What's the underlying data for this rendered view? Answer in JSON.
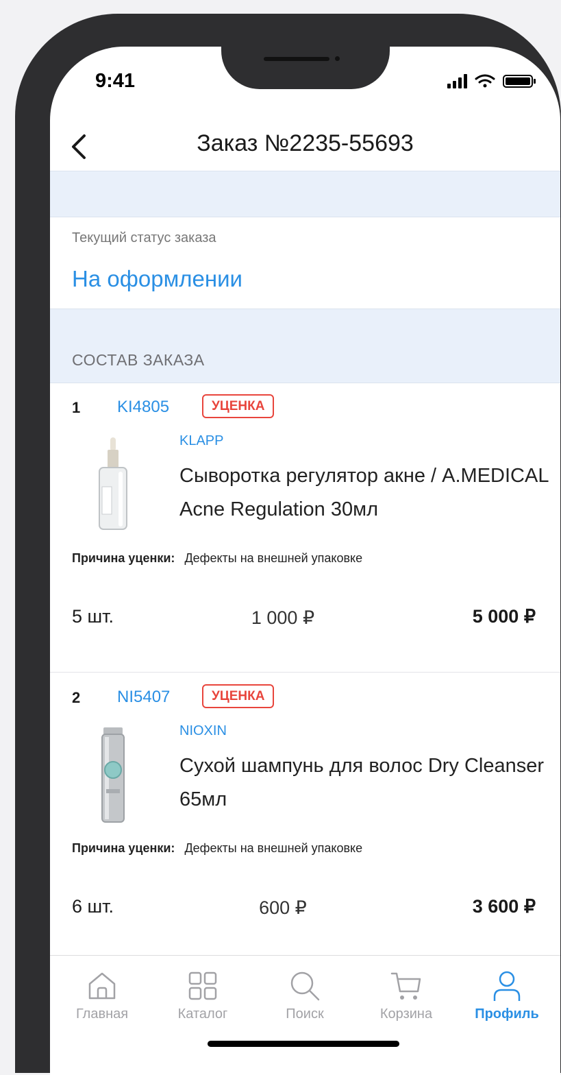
{
  "status_bar": {
    "time": "9:41"
  },
  "header": {
    "title": "Заказ №2235-55693"
  },
  "order_status": {
    "label": "Текущий статус заказа",
    "value": "На оформлении"
  },
  "section": {
    "title": "СОСТАВ ЗАКАЗА"
  },
  "items": [
    {
      "index": "1",
      "sku": "KI4805",
      "badge": "УЦЕНКА",
      "brand": "KLAPP",
      "name": "Сыворотка регулятор акне / A.MEDICAL Acne Regulation 30мл",
      "reason_label": "Причина уценки:",
      "reason": "Дефекты на внешней упаковке",
      "quantity": "5 шт.",
      "unit_price": "1 000 ₽",
      "total": "5 000 ₽"
    },
    {
      "index": "2",
      "sku": "NI5407",
      "badge": "УЦЕНКА",
      "brand": "NIOXIN",
      "name": "Сухой шампунь для волос Dry Cleanser 65мл",
      "reason_label": "Причина уценки:",
      "reason": "Дефекты на внешней упаковке",
      "quantity": "6 шт.",
      "unit_price": "600 ₽",
      "total": "3 600 ₽"
    }
  ],
  "tabbar": {
    "tabs": [
      {
        "label": "Главная",
        "icon": "home-icon"
      },
      {
        "label": "Каталог",
        "icon": "grid-icon"
      },
      {
        "label": "Поиск",
        "icon": "search-icon"
      },
      {
        "label": "Корзина",
        "icon": "cart-icon"
      },
      {
        "label": "Профиль",
        "icon": "profile-icon",
        "active": true
      }
    ]
  },
  "colors": {
    "accent": "#2a8fe4",
    "badge": "#e8453c",
    "band": "#e9f0fa"
  }
}
